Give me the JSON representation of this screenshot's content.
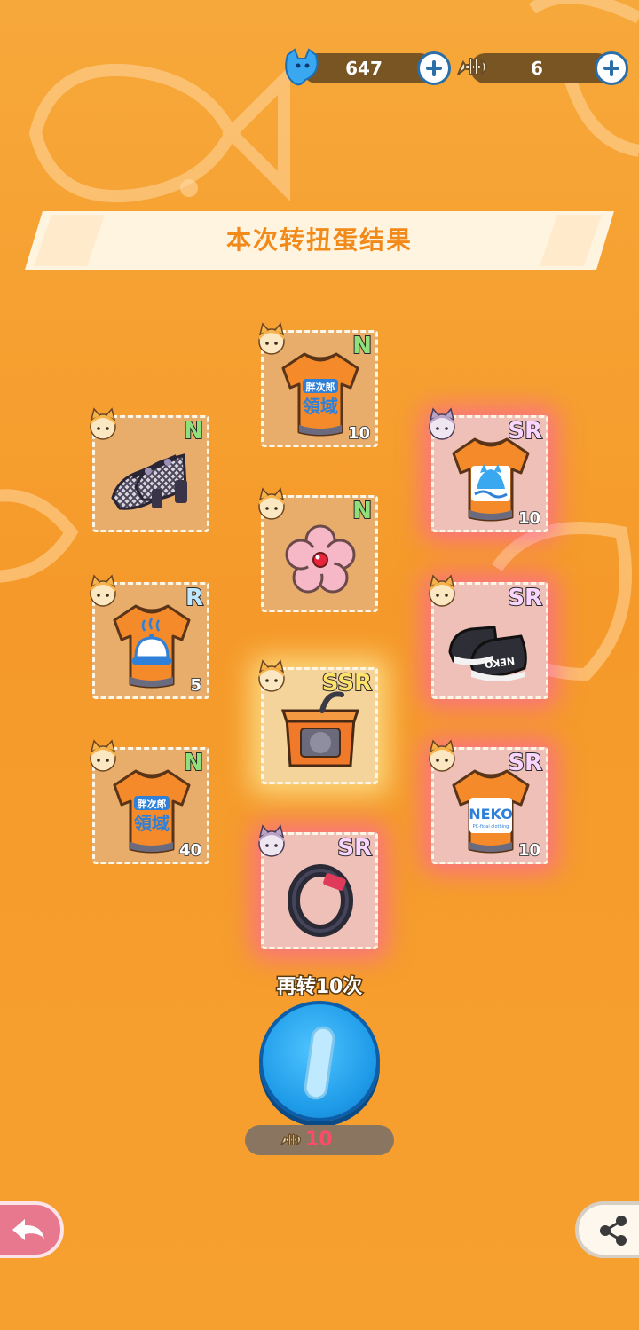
{
  "currency": {
    "gems": {
      "icon": "blue-cat-gem-icon",
      "value": "647"
    },
    "fishbones": {
      "icon": "fishbone-icon",
      "value": "6"
    }
  },
  "title": "本次转扭蛋结果",
  "items": [
    {
      "name": "tshirt-orange-text",
      "icon": "orange-tshirt-icon",
      "rarity": "N",
      "quantity": "10"
    },
    {
      "name": "plaid-shoes",
      "icon": "plaid-shoes-icon",
      "rarity": "N",
      "quantity": ""
    },
    {
      "name": "tshirt-cat-logo",
      "icon": "orange-tshirt-icon",
      "rarity": "SR",
      "quantity": "10"
    },
    {
      "name": "flower-hairclip",
      "icon": "flower-icon",
      "rarity": "N",
      "quantity": ""
    },
    {
      "name": "tshirt-bell-logo",
      "icon": "orange-tshirt-icon",
      "rarity": "R",
      "quantity": "5"
    },
    {
      "name": "black-sneakers",
      "icon": "sneakers-icon",
      "rarity": "SR",
      "quantity": ""
    },
    {
      "name": "cat-box-furniture",
      "icon": "cat-box-icon",
      "rarity": "SSR",
      "quantity": ""
    },
    {
      "name": "tshirt-orange-text-2",
      "icon": "orange-tshirt-icon",
      "rarity": "N",
      "quantity": "40"
    },
    {
      "name": "tshirt-neko",
      "icon": "orange-tshirt-icon",
      "rarity": "SR",
      "quantity": "10"
    },
    {
      "name": "black-bracelet",
      "icon": "bracelet-icon",
      "rarity": "SR",
      "quantity": ""
    }
  ],
  "tshirt_text": {
    "line1": "胖次郎",
    "line2": "領域",
    "neko": "NEKO",
    "neko_sub": "PC-fidai clothing"
  },
  "sneaker_text": "NEKO",
  "spin_again": {
    "label": "再转10次",
    "cost": "10",
    "cost_icon": "fishbone-icon"
  },
  "nav": {
    "back_icon": "back-arrow-icon",
    "share_icon": "share-icon"
  },
  "colors": {
    "background": "#f6a030",
    "title": "#f28a1a",
    "spin_button": "#1e9be8",
    "cost_text": "#ff4a6a"
  }
}
